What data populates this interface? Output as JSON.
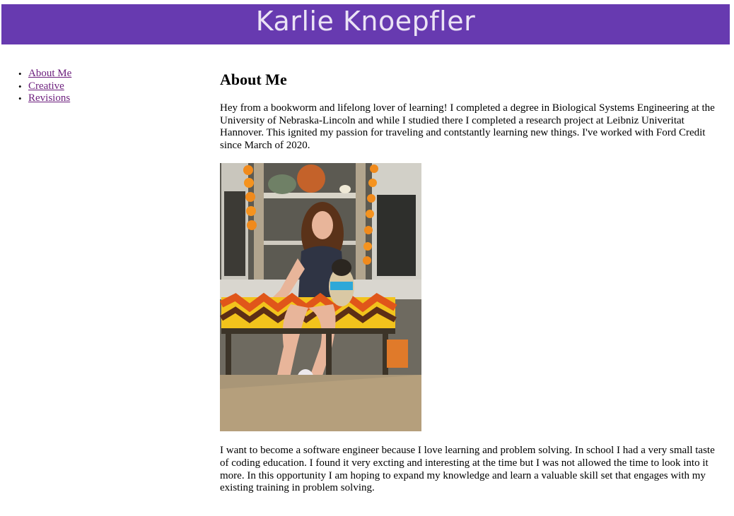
{
  "header": {
    "title": "Karlie Knoepfler",
    "background_color": "#673ab0",
    "title_color": "#ebe3f5"
  },
  "nav": {
    "items": [
      {
        "label": "About Me"
      },
      {
        "label": "Creative"
      },
      {
        "label": "Revisions"
      }
    ],
    "link_color": "#6b1d7c"
  },
  "main": {
    "heading": "About Me",
    "paragraphs": [
      "Hey from a bookworm and lifelong lover of learning! I completed a degree in Biological Systems Engineering at the University of Nebraska-Lincoln and while I studied there I completed a research project at Leibniz Univeritat Hannover. This ignited my passion for traveling and contstantly learning new things. I've worked with Ford Credit since March of 2020.",
      "I want to become a software engineer because I love learning and problem solving. In school I had a very small taste of coding education. I found it very excting and interesting at the time but I was not allowed the time to look into it more. In this opportunity I am hoping to expand my knowledge and learn a valuable skill set that engages with my existing training in problem solving."
    ]
  }
}
